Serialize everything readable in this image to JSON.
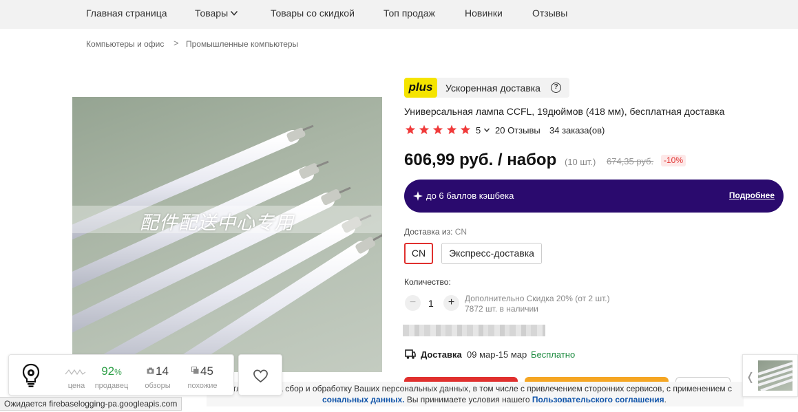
{
  "nav": {
    "items": [
      "Главная страница",
      "Товары",
      "Товары со скидкой",
      "Топ продаж",
      "Новинки",
      "Отзывы"
    ]
  },
  "breadcrumb": {
    "items": [
      "Компьютеры и офис",
      "Промышленные компьютеры"
    ],
    "separator": ">"
  },
  "photo": {
    "watermark": "配件配送中心专用"
  },
  "plus": {
    "logo": "plus",
    "label": "Ускоренная доставка",
    "help": "?"
  },
  "product": {
    "title": "Универсальная лампа CCFL, 19дюймов (418 мм), бесплатная доставка",
    "rating": "5",
    "stars": 5,
    "reviews": "20 Отзывы",
    "orders": "34 заказа(ов)",
    "price": "606,99 руб. / набор",
    "pack": "(10 шт.)",
    "old_price": "674,35 руб.",
    "discount": "-10%"
  },
  "cashback": {
    "text": "до 6 баллов кэшбека",
    "link": "Подробнее"
  },
  "shipping": {
    "label": "Доставка из:",
    "value": "CN",
    "options": [
      "CN",
      "Экспресс-доставка"
    ],
    "selected": "CN"
  },
  "quantity": {
    "label": "Количество:",
    "minus": "−",
    "plus": "+",
    "value": "1",
    "note_line1": "Дополнительно Скидка 20% (от 2 шт.)",
    "note_line2": "7872 шт. в наличии"
  },
  "delivery": {
    "label": "Доставка",
    "dates": "09 мар-15 мар",
    "free": "Бесплатно"
  },
  "widget": {
    "price_label": "цена",
    "sellers_value": "92",
    "sellers_pct": "%",
    "sellers_label": "продавец",
    "reviews_value": "14",
    "reviews_label": "обзоры",
    "similar_value": "45",
    "similar_label": "похожие"
  },
  "consent": {
    "line1": "глашаюсь на сбор и обработку Ваших персональных данных, в том числе с привлечением сторонних сервисов, с применением с",
    "line2_link1": "сональных данных.",
    "line2_text": " Вы принимаете условия нашего ",
    "line2_link2": "Пользовательского соглашения",
    "line2_end": "."
  },
  "status": {
    "text": "Ожидается firebaselogging-pa.googleapis.com"
  },
  "colors": {
    "accent_red": "#e0302e",
    "plus_yellow": "#f5e400",
    "cashback_purple": "#2a0a6e",
    "free_green": "#1b8a3e",
    "seller_green": "#2e9f47",
    "star_red": "#f03a3a"
  }
}
